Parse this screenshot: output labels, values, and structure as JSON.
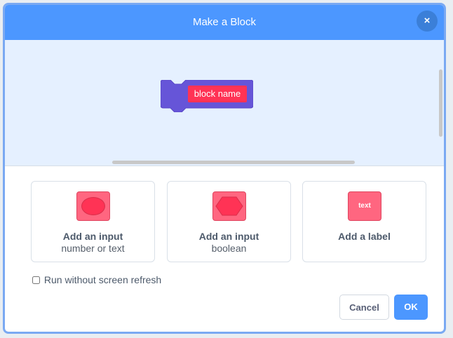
{
  "dialog": {
    "title": "Make a Block",
    "close_icon": "close-icon",
    "close_label": "×"
  },
  "block_preview": {
    "name": "block name",
    "block_color": "#6655d8",
    "label_color": "#ff3355"
  },
  "options": [
    {
      "icon": "oval-input-icon",
      "title": "Add an input",
      "subtitle": "number or text"
    },
    {
      "icon": "hexagon-input-icon",
      "title": "Add an input",
      "subtitle": "boolean"
    },
    {
      "icon": "text-label-icon",
      "icon_text": "text",
      "title": "Add a label",
      "subtitle": ""
    }
  ],
  "run_without_refresh": {
    "label": "Run without screen refresh",
    "checked": false
  },
  "buttons": {
    "cancel": "Cancel",
    "ok": "OK"
  },
  "colors": {
    "header": "#4c97ff",
    "workspace": "#e5f0ff",
    "accent": "#ff6680"
  }
}
